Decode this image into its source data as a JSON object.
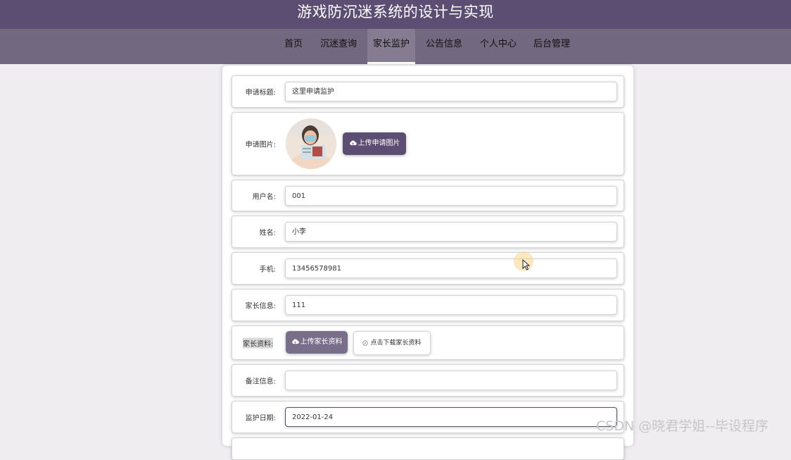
{
  "header": {
    "title": "游戏防沉迷系统的设计与实现"
  },
  "nav": {
    "items": [
      {
        "label": "首页"
      },
      {
        "label": "沉迷查询"
      },
      {
        "label": "家长监护"
      },
      {
        "label": "公告信息"
      },
      {
        "label": "个人中心"
      },
      {
        "label": "后台管理"
      }
    ],
    "active_index": 2
  },
  "form": {
    "apply_title": {
      "label": "申请标题:",
      "value": "这里申请监护"
    },
    "apply_image": {
      "label": "申请图片:",
      "upload_label": "上传申请图片"
    },
    "username": {
      "label": "用户名:",
      "value": "001"
    },
    "name": {
      "label": "姓名:",
      "value": "小李"
    },
    "phone": {
      "label": "手机:",
      "value": "13456578981"
    },
    "parent_info": {
      "label": "家长信息:",
      "value": "111"
    },
    "parent_docs": {
      "label": "家长资料:",
      "upload_label": "上传家长资料",
      "download_label": "点击下载家长资料"
    },
    "remark": {
      "label": "备注信息:",
      "value": ""
    },
    "monitor_date": {
      "label": "监护日期:",
      "value": "2022-01-24"
    }
  },
  "watermark": "CSDN @晓君学姐--毕设程序",
  "colors": {
    "primary": "#5c4d72",
    "nav": "#72687f",
    "button_dark": "#5c4d72",
    "button_mid": "#7a6f8a"
  },
  "icons": [
    "cloud-upload-icon",
    "download-icon",
    "cursor-icon"
  ]
}
